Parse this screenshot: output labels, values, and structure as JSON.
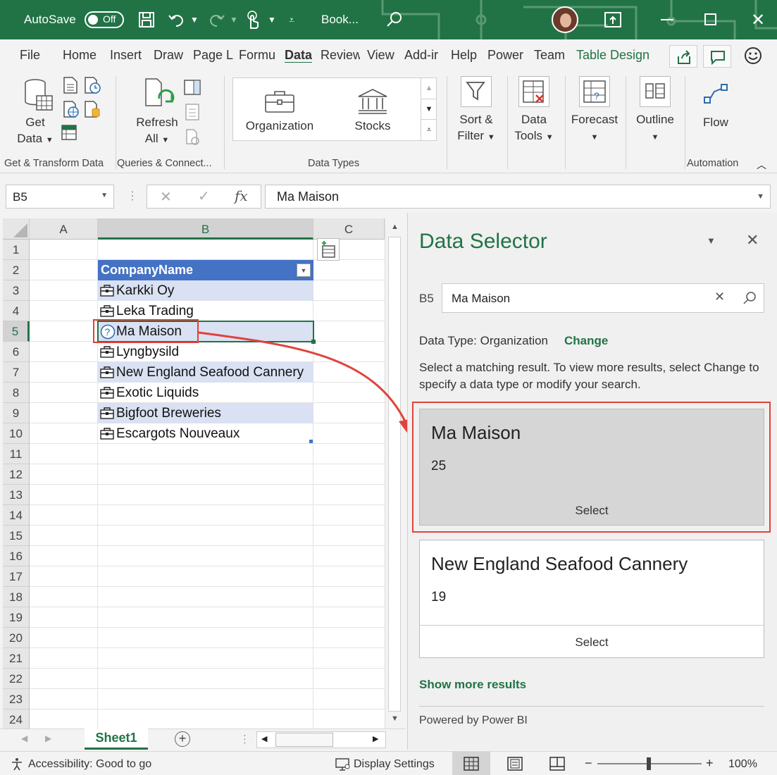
{
  "titlebar": {
    "autosave_label": "AutoSave",
    "autosave_state": "Off",
    "doc_title": "Book..."
  },
  "tabs": [
    "File",
    "Home",
    "Insert",
    "Draw",
    "Page L",
    "Formu",
    "Data",
    "Review",
    "View",
    "Add-ir",
    "Help",
    "Power",
    "Team",
    "Table Design"
  ],
  "ribbon": {
    "get_data": [
      "Get",
      "Data"
    ],
    "refresh": [
      "Refresh",
      "All"
    ],
    "group_get_transform": "Get & Transform Data",
    "group_queries": "Queries & Connect...",
    "datatype_org": "Organization",
    "datatype_stocks": "Stocks",
    "group_data_types": "Data Types",
    "sort_filter": [
      "Sort &",
      "Filter"
    ],
    "data_tools": [
      "Data",
      "Tools"
    ],
    "forecast": "Forecast",
    "outline": "Outline",
    "flow": "Flow",
    "group_automation": "Automation"
  },
  "formula": {
    "namebox": "B5",
    "content": "Ma Maison"
  },
  "sheet": {
    "columns": [
      "A",
      "B",
      "C"
    ],
    "rows": [
      "1",
      "2",
      "3",
      "4",
      "5",
      "6",
      "7",
      "8",
      "9",
      "10",
      "11",
      "12",
      "13",
      "14",
      "15",
      "16",
      "17",
      "18",
      "19",
      "20",
      "21",
      "22",
      "23",
      "24"
    ],
    "header": "CompanyName",
    "companies": [
      "Karkki Oy",
      "Leka Trading",
      "Ma Maison",
      "Lyngbysild",
      "New England Seafood Cannery",
      "Exotic Liquids",
      "Bigfoot Breweries",
      "Escargots Nouveaux"
    ],
    "tab": "Sheet1"
  },
  "pane": {
    "title": "Data Selector",
    "cell_ref": "B5",
    "search_value": "Ma Maison",
    "datatype_label": "Data Type: Organization",
    "change_link": "Change",
    "instructions": "Select a matching result. To view more results, select Change to specify a data type or modify your search.",
    "results": [
      {
        "name": "Ma Maison",
        "value": "25",
        "action": "Select"
      },
      {
        "name": "New England Seafood Cannery",
        "value": "19",
        "action": "Select"
      }
    ],
    "show_more": "Show more results",
    "powered_by": "Powered by Power BI"
  },
  "status": {
    "accessibility": "Accessibility: Good to go",
    "display_settings": "Display Settings",
    "zoom": "100%"
  },
  "colors": {
    "excel_green": "#217346",
    "table_header": "#4472c4",
    "band": "#d9e1f2",
    "highlight": "#e0433b"
  }
}
